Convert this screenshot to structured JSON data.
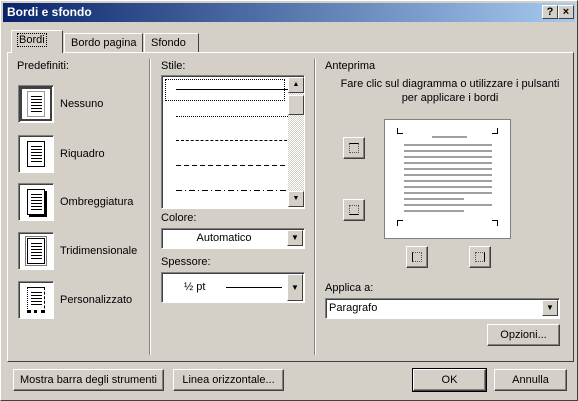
{
  "window": {
    "title": "Bordi e sfondo",
    "help_button": "?",
    "close_button": "×"
  },
  "tabs": [
    {
      "label": "Bordi",
      "active": true
    },
    {
      "label": "Bordo pagina",
      "active": false
    },
    {
      "label": "Sfondo",
      "active": false
    }
  ],
  "predefiniti": {
    "heading": "Predefiniti:",
    "items": [
      {
        "label": "Nessuno",
        "icon": "preset-none-icon"
      },
      {
        "label": "Riquadro",
        "icon": "preset-box-icon"
      },
      {
        "label": "Ombreggiatura",
        "icon": "preset-shadow-icon"
      },
      {
        "label": "Tridimensionale",
        "icon": "preset-3d-icon"
      },
      {
        "label": "Personalizzato",
        "icon": "preset-custom-icon"
      }
    ]
  },
  "stile": {
    "heading": "Stile:",
    "line_styles": [
      "solid",
      "dotted",
      "dashed-small",
      "dashed",
      "dash-dot"
    ]
  },
  "colore": {
    "heading": "Colore:",
    "value": "Automatico"
  },
  "spessore": {
    "heading": "Spessore:",
    "value": "½ pt"
  },
  "anteprima": {
    "heading": "Anteprima",
    "instruction": "Fare clic sul diagramma o utilizzare i pulsanti per applicare i bordi"
  },
  "applica": {
    "heading": "Applica a:",
    "value": "Paragrafo"
  },
  "buttons": {
    "opzioni": "Opzioni...",
    "mostra_barra": "Mostra barra degli strumenti",
    "linea_orizzontale": "Linea orizzontale...",
    "ok": "OK",
    "annulla": "Annulla"
  },
  "colors": {
    "titlebar_start": "#0a246a",
    "titlebar_end": "#a6caf0",
    "face": "#d4d0c8"
  }
}
